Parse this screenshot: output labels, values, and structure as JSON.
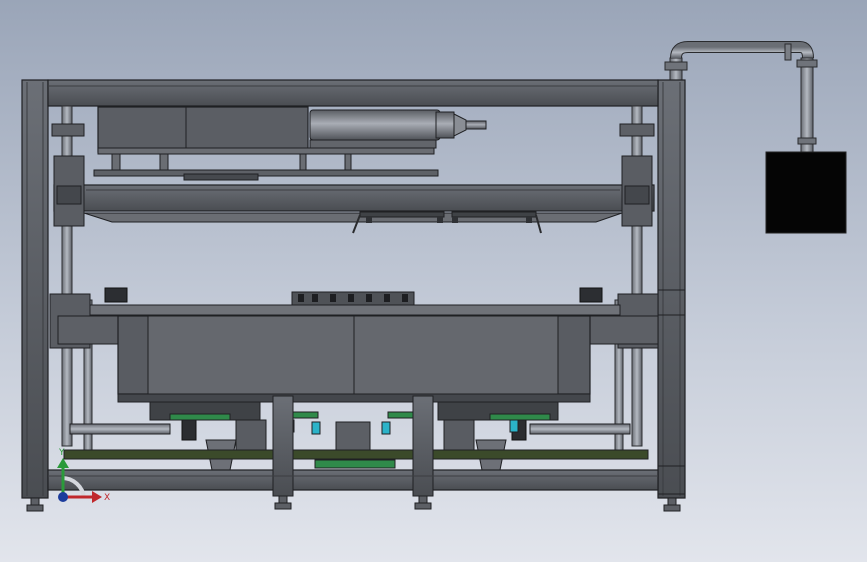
{
  "view": {
    "background_top": "#9aa5b8",
    "background_bottom": "#e2e5ec",
    "steel_color": "#55585d",
    "edge_color": "#1f2023",
    "guard_green": "#2f8a4a",
    "sensor_cyan": "#2bb3c9",
    "motor_box_color": "#050505"
  },
  "triad": {
    "x_label": "X",
    "y_label": "Y",
    "x_color": "#c0282c",
    "y_color": "#2a9a3a",
    "origin_color": "#1c3c9c"
  }
}
